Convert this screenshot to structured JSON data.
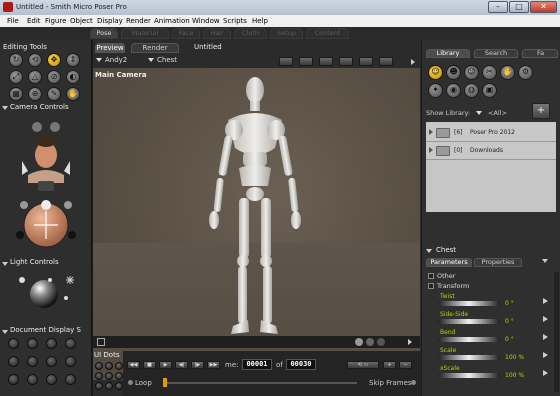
{
  "app": {
    "title": "Untitled - Smith Micro Poser Pro"
  },
  "menu": [
    "File",
    "Edit",
    "Figure",
    "Object",
    "Display",
    "Render",
    "Animation",
    "Window",
    "Scripts",
    "Help"
  ],
  "rooms": [
    "Pose",
    "Material",
    "Face",
    "Hair",
    "Cloth",
    "Setup",
    "Content"
  ],
  "left": {
    "editing_tools_title": "Editing Tools",
    "camera_controls_title": "Camera Controls",
    "light_controls_title": "Light Controls",
    "document_display_title": "Document Display S",
    "ui_dots_title": "UI Dots"
  },
  "document": {
    "tabs": [
      "Preview",
      "Render"
    ],
    "doc_title": "Untitled",
    "figure_select": "Andy2",
    "actor_select": "Chest",
    "camera_label": "Main Camera"
  },
  "timeline": {
    "frame_label": "me:",
    "current_frame": "00001",
    "of_label": "of",
    "total_frames": "00030",
    "loop_label": "Loop",
    "skip_frames_label": "Skip Frames"
  },
  "library": {
    "tabs": [
      "Library",
      "Search",
      "Fa"
    ],
    "show_library_label": "Show Library:",
    "show_library_value": "<All>",
    "items": [
      {
        "count": "[6]",
        "name": "Poser Pro 2012"
      },
      {
        "count": "[0]",
        "name": "Downloads"
      }
    ]
  },
  "params": {
    "actor": "Chest",
    "tabs": [
      "Parameters",
      "Properties"
    ],
    "groups": [
      "Other",
      "Transform"
    ],
    "rows": [
      {
        "label": "Twist",
        "value": "0 °"
      },
      {
        "label": "Side-Side",
        "value": "0 °"
      },
      {
        "label": "Bend",
        "value": "0 °"
      },
      {
        "label": "Scale",
        "value": "100 %"
      },
      {
        "label": "xScale",
        "value": "100 %"
      }
    ]
  },
  "colors": {
    "accent": "#b7d400",
    "tool_selected": "#f0b800",
    "viewport": "#5d5347"
  }
}
